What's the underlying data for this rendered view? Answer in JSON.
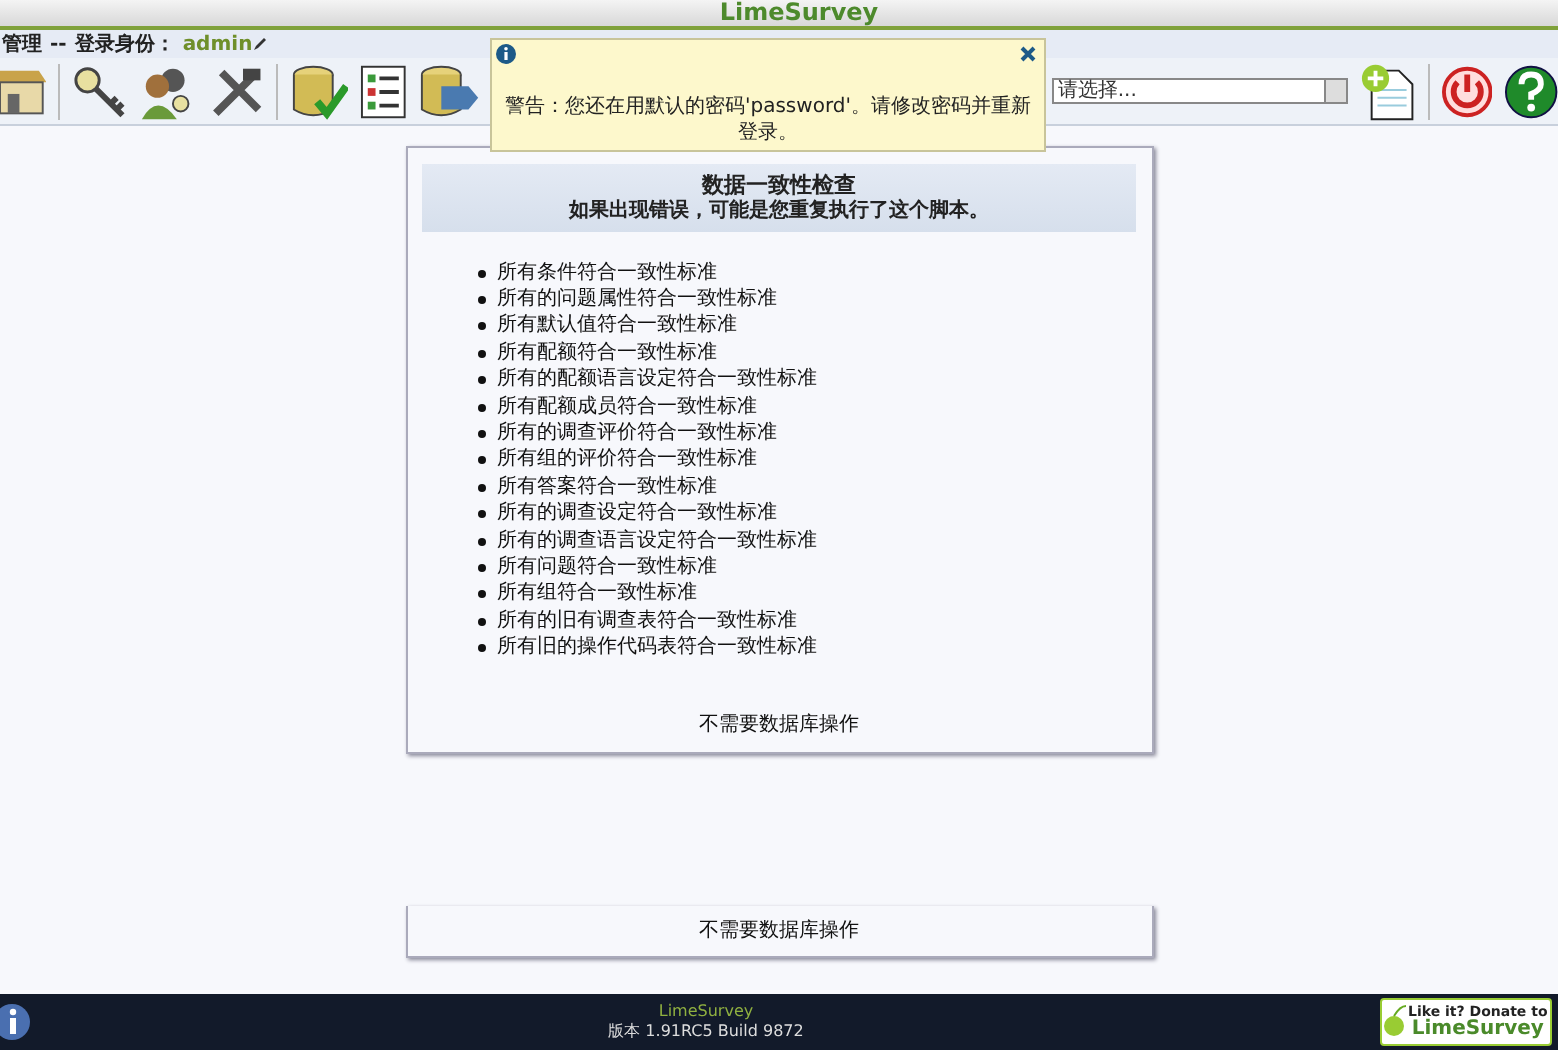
{
  "header": {
    "title": "LimeSurvey"
  },
  "user_bar": {
    "section": "管理",
    "separator": "--",
    "login_label": "登录身份：",
    "username": "admin"
  },
  "survey_select": {
    "placeholder": "请选择..."
  },
  "notification": {
    "message": "警告：您还在用默认的密码'password'。请修改密码并重新登录。"
  },
  "integrity_check": {
    "title": "数据一致性检查",
    "subtitle": "如果出现错误，可能是您重复执行了这个脚本。",
    "items": [
      "所有条件符合一致性标准",
      "所有的问题属性符合一致性标准",
      "所有默认值符合一致性标准",
      "所有配额符合一致性标准",
      "所有的配额语言设定符合一致性标准",
      "所有配额成员符合一致性标准",
      "所有的调查评价符合一致性标准",
      "所有组的评价符合一致性标准",
      "所有答案符合一致性标准",
      "所有的调查设定符合一致性标准",
      "所有的调查语言设定符合一致性标准",
      "所有问题符合一致性标准",
      "所有组符合一致性标准",
      "所有的旧有调查表符合一致性标准",
      "所有旧的操作代码表符合一致性标准"
    ],
    "result": "不需要数据库操作"
  },
  "second_panel": {
    "result": "不需要数据库操作"
  },
  "footer": {
    "product": "LimeSurvey",
    "version": "版本 1.91RC5 Build 9872",
    "donate_line1": "Like it? Donate to",
    "donate_line2": "LimeSurvey"
  }
}
